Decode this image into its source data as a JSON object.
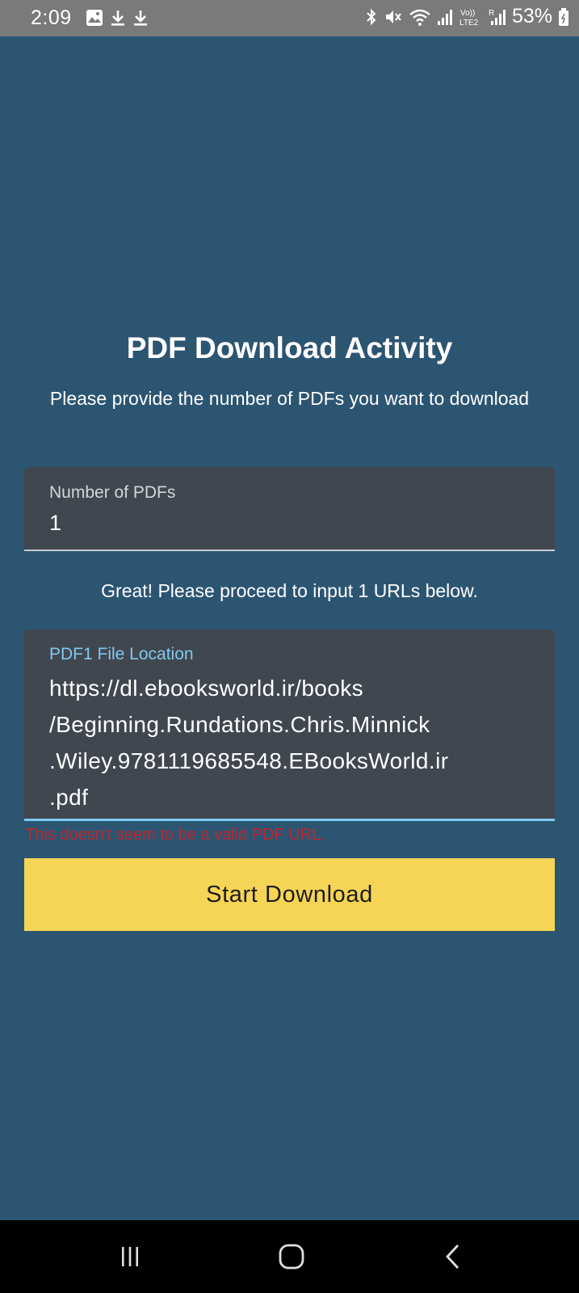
{
  "status_bar": {
    "time": "2:09",
    "battery": "53%",
    "left_icons": [
      "image-icon",
      "download-icon",
      "download-icon"
    ],
    "right_icons": [
      "bluetooth-icon",
      "mute-icon",
      "wifi-icon",
      "signal-icon",
      "volte-lte2-icon",
      "signal-icon",
      "battery-icon"
    ],
    "volte_label": "Vo)) LTE2"
  },
  "page": {
    "title": "PDF Download Activity",
    "instructions": "Please provide the number of PDFs you want to download"
  },
  "count_field": {
    "label": "Number of PDFs",
    "value": "1"
  },
  "proceed_message": "Great! Please proceed to input 1 URLs below.",
  "url_field": {
    "label": "PDF1 File Location",
    "value": "https://dl.ebooksworld.ir/books\n/Beginning.Rundations.Chris.Minnick\n.Wiley.9781119685548.EBooksWorld.ir\n.pdf",
    "error": "This doesn't seem to be a valid PDF URL."
  },
  "start_button": {
    "label": "Start Download"
  },
  "nav_bar": {
    "icons": [
      "recents-icon",
      "home-icon",
      "back-icon"
    ]
  },
  "colors": {
    "background": "#2c5572",
    "field_background": "#41474f",
    "accent": "#80c8f0",
    "error": "#c0262c",
    "button": "#f6d455"
  }
}
